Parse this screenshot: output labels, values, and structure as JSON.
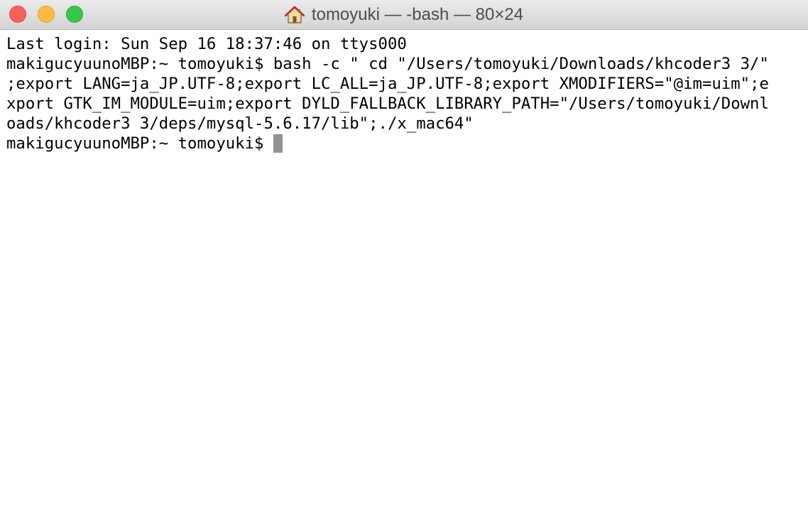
{
  "window": {
    "title": "tomoyuki — -bash — 80×24",
    "title_icon": "home-icon",
    "controls": [
      "close",
      "minimize",
      "zoom"
    ]
  },
  "terminal": {
    "lines": [
      "Last login: Sun Sep 16 18:37:46 on ttys000",
      "makigucyuunoMBP:~ tomoyuki$ bash -c \" cd \"/Users/tomoyuki/Downloads/khcoder3 3/\"",
      ";export LANG=ja_JP.UTF-8;export LC_ALL=ja_JP.UTF-8;export XMODIFIERS=\"@im=uim\";e",
      "xport GTK_IM_MODULE=uim;export DYLD_FALLBACK_LIBRARY_PATH=\"/Users/tomoyuki/Downl",
      "oads/khcoder3 3/deps/mysql-5.6.17/lib\";./x_mac64\""
    ],
    "prompt": "makigucyuunoMBP:~ tomoyuki$ "
  },
  "colors": {
    "titlebar_top": "#ebebeb",
    "titlebar_bottom": "#d4d4d4",
    "close": "#fc605b",
    "minimize": "#fdbc40",
    "zoom": "#34c84a",
    "text": "#000000",
    "cursor": "#929292",
    "background": "#ffffff"
  }
}
